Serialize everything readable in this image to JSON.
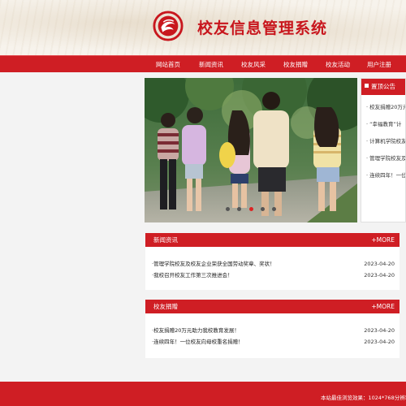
{
  "header": {
    "title": "校友信息管理系统",
    "logo_icon": "red-seal-logo-icon",
    "accent_color": "#cf1e24"
  },
  "nav": {
    "items": [
      {
        "label": "网站首页"
      },
      {
        "label": "新闻资讯"
      },
      {
        "label": "校友风采"
      },
      {
        "label": "校友捐赠"
      },
      {
        "label": "校友活动"
      },
      {
        "label": "用户注册"
      }
    ]
  },
  "slider": {
    "image_icon": "campus-students-photo",
    "dot_count": 5,
    "active_dot": 2
  },
  "notice": {
    "title": "置顶公告",
    "items": [
      {
        "text": "· 校友捐赠20万元"
      },
      {
        "text": "· “幸福教育”计"
      },
      {
        "text": "· 计算机学院校友"
      },
      {
        "text": "· 管理学院校友及"
      },
      {
        "text": "· 连续四年！一位"
      }
    ]
  },
  "news": {
    "title": "新闻资讯",
    "more": "+MORE",
    "items": [
      {
        "text": "·管理学院校友及校友企业荣获全国劳动奖章、奖状！",
        "date": "2023-04-20"
      },
      {
        "text": "·我校召开校友工作第三次推进会！",
        "date": "2023-04-20"
      }
    ]
  },
  "donation": {
    "title": "校友捐赠",
    "more": "+MORE",
    "items": [
      {
        "text": "·校友捐赠20万元助力我校教育发展！",
        "date": "2023-04-20"
      },
      {
        "text": "·连续四年！一位校友向母校重名捐赠！",
        "date": "2023-04-20"
      }
    ]
  },
  "footer": {
    "text": "本站最佳浏览效果：1024*768分辨率"
  }
}
